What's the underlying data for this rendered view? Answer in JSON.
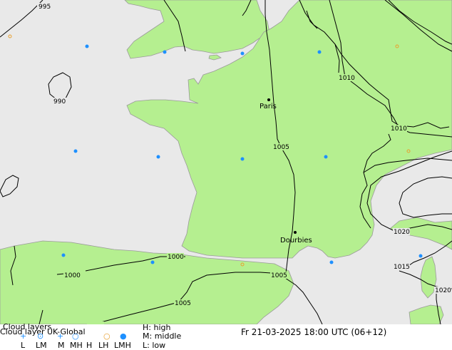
{
  "colors": {
    "sea": "#e9e9e9",
    "land": "#b5ef90",
    "border": "#000000",
    "coast": "#9a9a9a",
    "isobar": "#000000",
    "dot_blue": "#1e90ff",
    "dot_orange": "#e8a030"
  },
  "map": {
    "isobar_labels": [
      "995",
      "990",
      "1010",
      "1010",
      "1005",
      "1000",
      "1000",
      "1005",
      "1005",
      "1020",
      "1015",
      "1020",
      "1005"
    ],
    "cities": [
      {
        "name": "Paris"
      },
      {
        "name": "Dourbies"
      }
    ],
    "cloud_markers": [
      {
        "type": "blue",
        "icon": "cloud-dot-icon"
      },
      {
        "type": "blue",
        "icon": "cloud-dot-icon"
      },
      {
        "type": "blue",
        "icon": "cloud-dot-icon"
      },
      {
        "type": "blue",
        "icon": "cloud-dot-icon"
      },
      {
        "type": "blue",
        "icon": "cloud-dot-icon"
      },
      {
        "type": "blue",
        "icon": "cloud-dot-icon"
      },
      {
        "type": "blue",
        "icon": "cloud-dot-icon"
      },
      {
        "type": "blue",
        "icon": "cloud-dot-icon"
      },
      {
        "type": "blue",
        "icon": "cloud-dot-icon"
      },
      {
        "type": "blue",
        "icon": "cloud-dot-icon"
      },
      {
        "type": "blue",
        "icon": "cloud-dot-icon"
      },
      {
        "type": "blue",
        "icon": "cloud-dot-icon"
      },
      {
        "type": "orange",
        "icon": "cloud-ring-icon"
      },
      {
        "type": "orange",
        "icon": "cloud-ring-icon"
      },
      {
        "type": "orange",
        "icon": "cloud-ring-icon"
      },
      {
        "type": "orange",
        "icon": "cloud-ring-icon"
      }
    ]
  },
  "footer": {
    "legend_title": "Cloud layers",
    "model_line": "Cloud layer  UK-Global",
    "h_key": "H: high",
    "m_key": "M: middle",
    "l_key": "L: low",
    "datetime": "Fr 21-03-2025 18:00 UTC (06+12)",
    "legend_codes": [
      "L",
      "LM",
      "M",
      "MH",
      "H",
      "LH",
      "LMH"
    ]
  }
}
